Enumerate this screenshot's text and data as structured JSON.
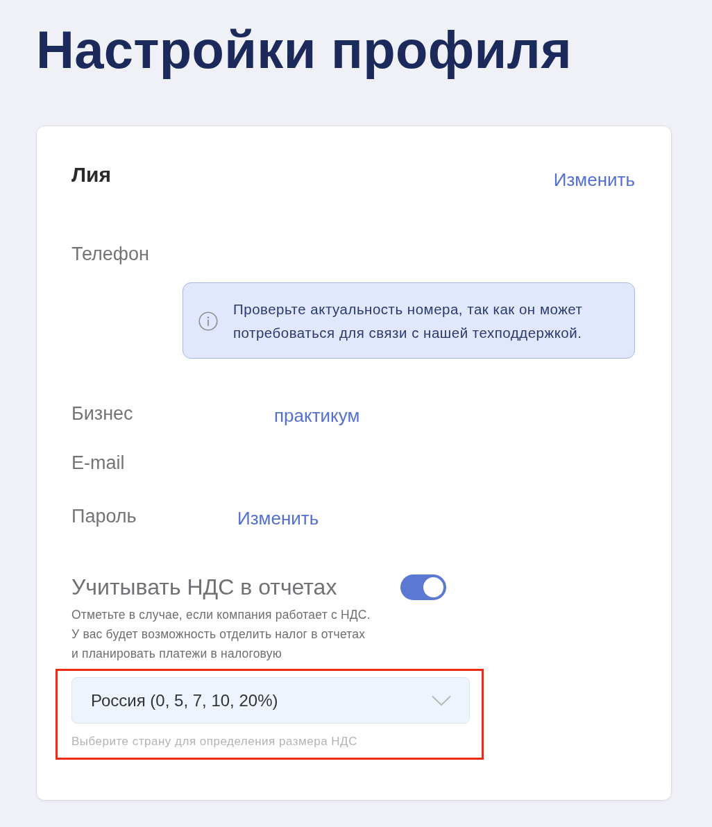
{
  "page": {
    "title": "Настройки профиля"
  },
  "profile": {
    "name": "Лия",
    "edit_link": "Изменить"
  },
  "phone": {
    "label": "Телефон",
    "notice": "Проверьте актуальность номера, так как он может потребоваться для связи с нашей техподдержкой."
  },
  "fields": [
    {
      "label": "Бизнес",
      "value": "практикум"
    },
    {
      "label": "E-mail"
    },
    {
      "label": "Пароль",
      "value": "Изменить"
    }
  ],
  "vat": {
    "label": "Учитывать НДС в отчетах",
    "on": true,
    "description": "Отметьте в случае, если компания работает с НДС. У вас будет возможность отделить налог в отчетах и планировать платежи в налоговую"
  },
  "vat_country": {
    "value": "Россия (0, 5, 7, 10, 20%)",
    "hint": "Выберите страну для определения размера НДС",
    "highlighted": true
  }
}
